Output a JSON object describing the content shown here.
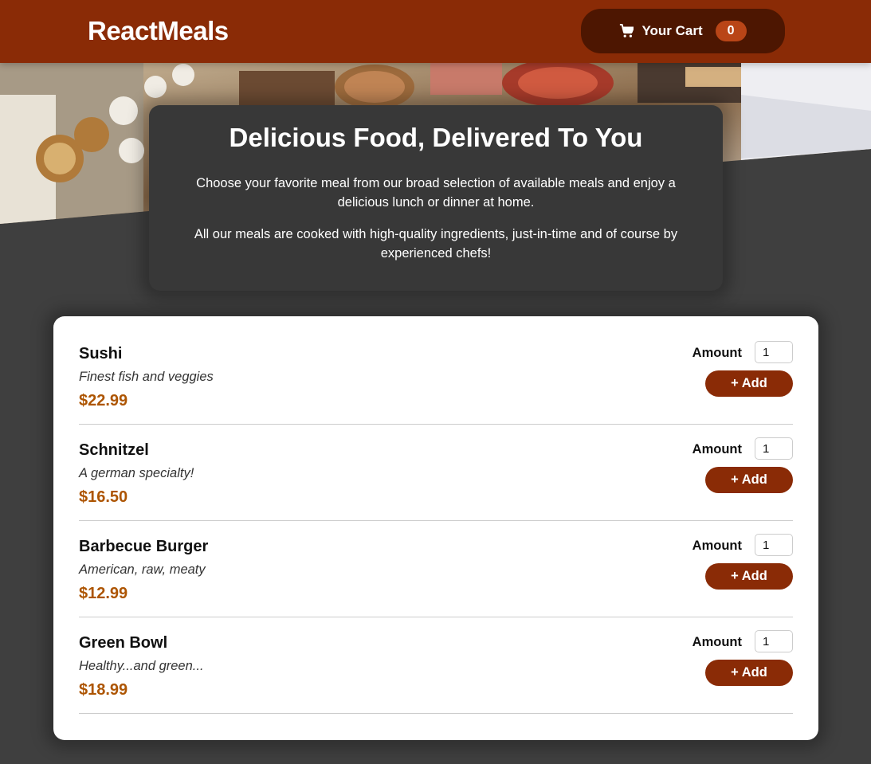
{
  "header": {
    "brand": "ReactMeals",
    "cart": {
      "label": "Your Cart",
      "count": "0",
      "icon": "cart-icon"
    }
  },
  "hero": {
    "image": "buffet-table-food-photo"
  },
  "summary": {
    "title": "Delicious Food, Delivered To You",
    "paragraph1": "Choose your favorite meal from our broad selection of available meals and enjoy a delicious lunch or dinner at home.",
    "paragraph2": "All our meals are cooked with high-quality ingredients, just-in-time and of course by experienced chefs!"
  },
  "meals": [
    {
      "name": "Sushi",
      "description": "Finest fish and veggies",
      "price": "$22.99",
      "amount_label": "Amount",
      "amount_value": "1",
      "add_label": "+ Add"
    },
    {
      "name": "Schnitzel",
      "description": "A german specialty!",
      "price": "$16.50",
      "amount_label": "Amount",
      "amount_value": "1",
      "add_label": "+ Add"
    },
    {
      "name": "Barbecue Burger",
      "description": "American, raw, meaty",
      "price": "$12.99",
      "amount_label": "Amount",
      "amount_value": "1",
      "add_label": "+ Add"
    },
    {
      "name": "Green Bowl",
      "description": "Healthy...and green...",
      "price": "$18.99",
      "amount_label": "Amount",
      "amount_value": "1",
      "add_label": "+ Add"
    }
  ],
  "colors": {
    "header": "#8a2b06",
    "cart_button": "#4d1601",
    "badge": "#b94517",
    "price": "#ad5502",
    "background": "#3f3f3f"
  }
}
